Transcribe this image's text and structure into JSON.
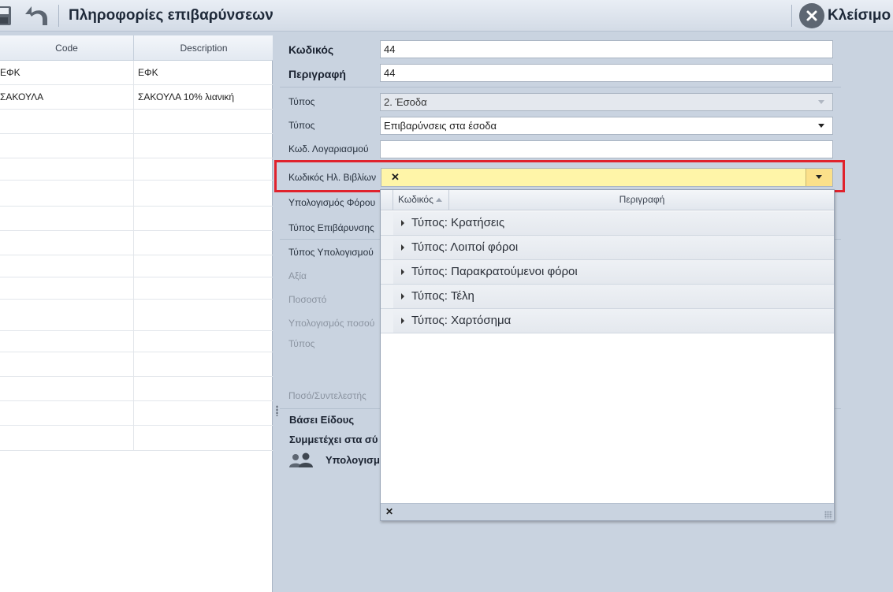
{
  "window": {
    "title": "Πληροφορίες επιβαρύνσεων",
    "close_label": "Κλείσιμο"
  },
  "grid": {
    "columns": [
      "Code",
      "Description"
    ],
    "rows": [
      {
        "code": "ΕΦΚ",
        "description": "ΕΦΚ"
      },
      {
        "code": "ΣΑΚΟΥΛΑ",
        "description": "ΣΑΚΟΥΛΑ 10% λιανική"
      }
    ]
  },
  "form": {
    "code_label": "Κωδικός",
    "code_value": "44",
    "description_label": "Περιγραφή",
    "description_value": "44",
    "type1_label": "Τύπος",
    "type1_value": "2. Έσοδα",
    "type2_label": "Τύπος",
    "type2_value": "Επιβαρύνσεις στα έσοδα",
    "account_code_label": "Κωδ. Λογαριασμού",
    "account_code_value": "",
    "ebooks_code_label": "Κωδικός Ηλ. Βιβλίων",
    "ebooks_clear": "✕",
    "tax_calc_label": "Υπολογισμός Φόρου",
    "charge_type_label": "Τύπος Επιβάρυνσης",
    "calc_type_label": "Τύπος Υπολογισμού",
    "value_label": "Αξία",
    "percent_label": "Ποσοστό",
    "amount_calc_label": "Υπολογισμός ποσού",
    "type3_label": "Τύπος",
    "amount_factor_label": "Ποσό/Συντελεστής",
    "per_item_label": "Βάσει Είδους",
    "participates_label": "Συμμετέχει στα σύ",
    "calc_section_label": "Υπολογισμ"
  },
  "dropdown": {
    "columns": [
      "Κωδικός",
      "Περιγραφή"
    ],
    "groups": [
      "Τύπος: Κρατήσεις",
      "Τύπος: Λοιποί φόροι",
      "Τύπος: Παρακρατούμενοι φόροι",
      "Τύπος: Τέλη",
      "Τύπος: Χαρτόσημα"
    ],
    "footer_clear": "✕"
  },
  "colors": {
    "highlight": "#e0222c",
    "selected_field": "#fff5a8",
    "panel": "#c9d3e0"
  }
}
